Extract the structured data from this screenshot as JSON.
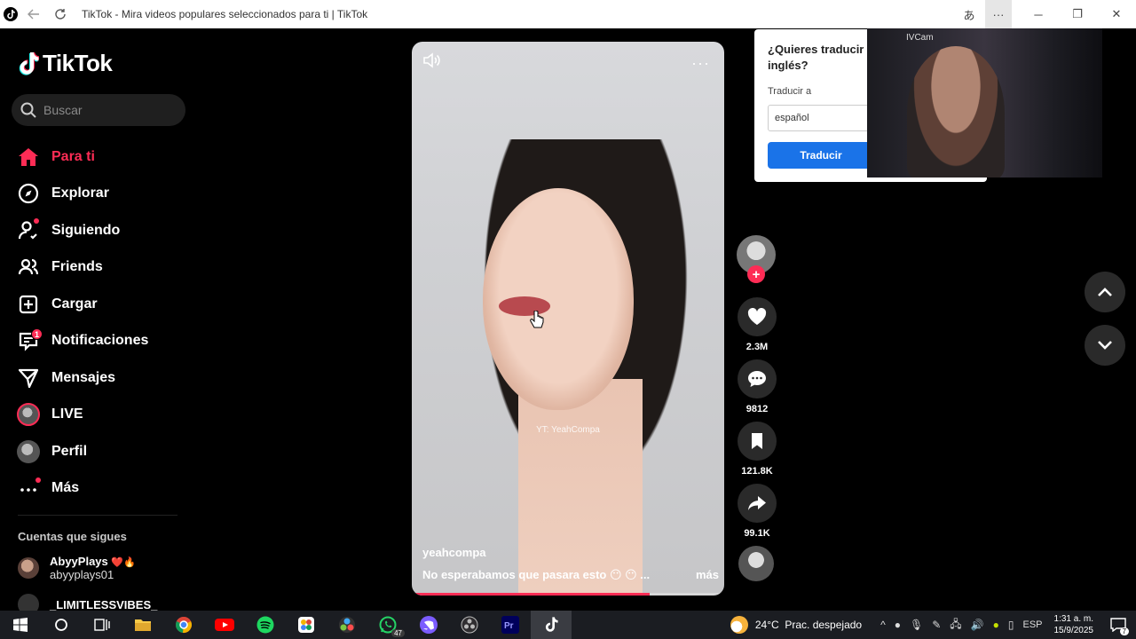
{
  "window": {
    "title": "TikTok - Mira videos populares seleccionados para ti | TikTok"
  },
  "sidebar": {
    "logo": "TikTok",
    "search_placeholder": "Buscar",
    "nav": [
      {
        "label": "Para ti",
        "icon": "home-icon"
      },
      {
        "label": "Explorar",
        "icon": "compass-icon"
      },
      {
        "label": "Siguiendo",
        "icon": "following-icon"
      },
      {
        "label": "Friends",
        "icon": "friends-icon"
      },
      {
        "label": "Cargar",
        "icon": "upload-icon"
      },
      {
        "label": "Notificaciones",
        "icon": "inbox-icon",
        "badge": "1"
      },
      {
        "label": "Mensajes",
        "icon": "send-icon"
      },
      {
        "label": "LIVE",
        "icon": "live-avatar"
      },
      {
        "label": "Perfil",
        "icon": "profile-avatar"
      },
      {
        "label": "Más",
        "icon": "more-icon"
      }
    ],
    "following_title": "Cuentas que sigues",
    "accounts": [
      {
        "name": "AbyyPlays",
        "handle": "abyyplays01"
      },
      {
        "name": "_LIMITLESSVIBES_",
        "handle": ""
      }
    ]
  },
  "video": {
    "username": "yeahcompa",
    "description": "No esperabamos que pasara esto 😶 😶 ...",
    "more_label": "más",
    "watermark": "YT: YeahCompa",
    "progress_fraction": 0.76
  },
  "actions": {
    "likes": "2.3M",
    "comments": "9812",
    "saves": "121.8K",
    "shares": "99.1K"
  },
  "translate": {
    "question": "¿Quieres traducir l inglés?",
    "label": "Traducir a",
    "language": "español",
    "button": "Traducir"
  },
  "webcam": {
    "label": "IVCam"
  },
  "taskbar": {
    "temperature": "24°C",
    "weather": "Prac. despejado",
    "language": "ESP",
    "time": "1:31 a. m.",
    "date": "15/9/2025",
    "whatsapp_badge": "47",
    "notif_count": "7"
  },
  "colors": {
    "accent": "#fe2c55",
    "translate_button": "#1a73e8"
  }
}
